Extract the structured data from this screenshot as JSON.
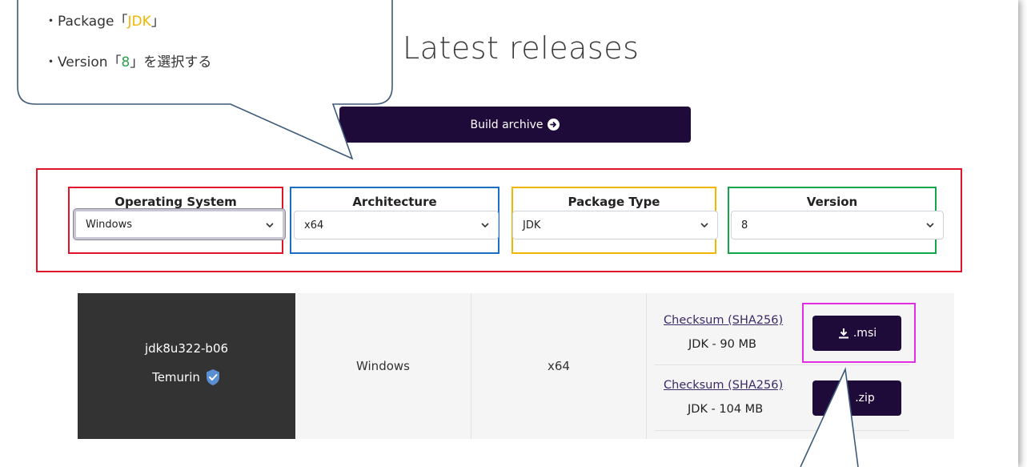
{
  "page": {
    "title": "Latest releases"
  },
  "build_button": {
    "label": "Build archive"
  },
  "callout": {
    "line1_prefix": "・Package「",
    "line1_value": "JDK",
    "line1_suffix": "」",
    "line2_prefix": "・Version「",
    "line2_value": "8",
    "line2_suffix": "」を選択する",
    "colors": {
      "jdk": "#f2b600",
      "version": "#2aa44a"
    }
  },
  "filters": {
    "os": {
      "label": "Operating System",
      "value": "Windows"
    },
    "arch": {
      "label": "Architecture",
      "value": "x64"
    },
    "package": {
      "label": "Package Type",
      "value": "JDK"
    },
    "version": {
      "label": "Version",
      "value": "8"
    }
  },
  "release": {
    "name": "jdk8u322-b06",
    "vendor": "Temurin",
    "os": "Windows",
    "arch": "x64",
    "downloads": [
      {
        "checksum": "Checksum (SHA256)",
        "size": "JDK - 90 MB",
        "button": ".msi"
      },
      {
        "checksum": "Checksum (SHA256)",
        "size": "JDK - 104 MB",
        "button": ".zip"
      }
    ]
  },
  "colors": {
    "brand_dark": "#1e0b3a",
    "highlight_filters": "#e0142a",
    "highlight_os": "#e0142a",
    "highlight_arch": "#1a6fc4",
    "highlight_package": "#f2b600",
    "highlight_version": "#14a64a",
    "highlight_msi": "#e02ee0",
    "callout_border": "#3d5a7a"
  }
}
